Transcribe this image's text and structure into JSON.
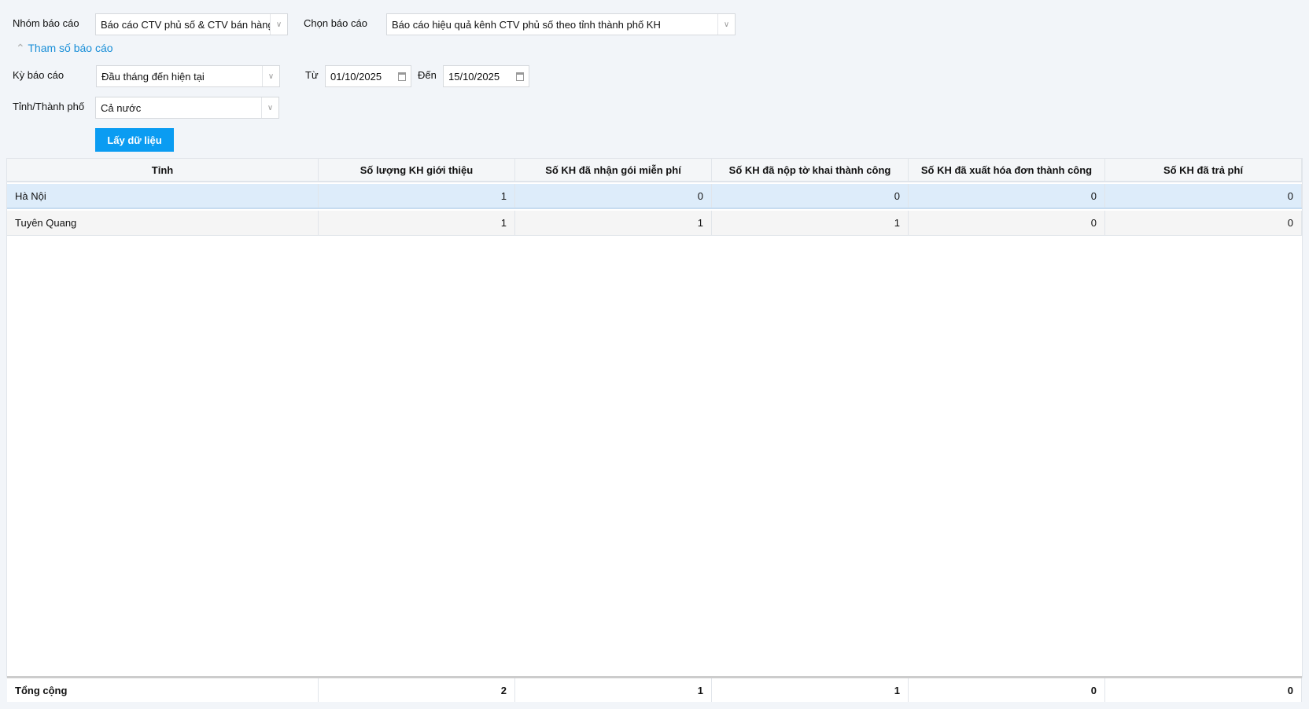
{
  "filters": {
    "group_label": "Nhóm báo cáo",
    "group_value": "Báo cáo CTV phủ số & CTV bán hàng",
    "report_label": "Chọn báo cáo",
    "report_value": "Báo cáo hiệu quả kênh CTV phủ số theo tỉnh thành phố KH",
    "params_toggle": "Tham số báo cáo",
    "period_label": "Kỳ báo cáo",
    "period_value": "Đầu tháng đến hiện tại",
    "from_label": "Từ",
    "from_value": "01/10/2025",
    "to_label": "Đến",
    "to_value": "15/10/2025",
    "province_label": "Tỉnh/Thành phố",
    "province_value": "Cả nước",
    "fetch_button": "Lấy dữ liệu"
  },
  "table": {
    "headers": [
      "Tỉnh",
      "Số lượng KH giới thiệu",
      "Số KH đã nhận gói miễn phí",
      "Số KH đã nộp tờ khai thành công",
      "Số KH đã xuất hóa đơn thành công",
      "Số KH đã trả phí"
    ],
    "rows": [
      [
        "Hà Nội",
        "1",
        "0",
        "0",
        "0",
        "0"
      ],
      [
        "Tuyên Quang",
        "1",
        "1",
        "1",
        "0",
        "0"
      ]
    ],
    "footer": [
      "Tổng cộng",
      "2",
      "1",
      "1",
      "0",
      "0"
    ]
  }
}
